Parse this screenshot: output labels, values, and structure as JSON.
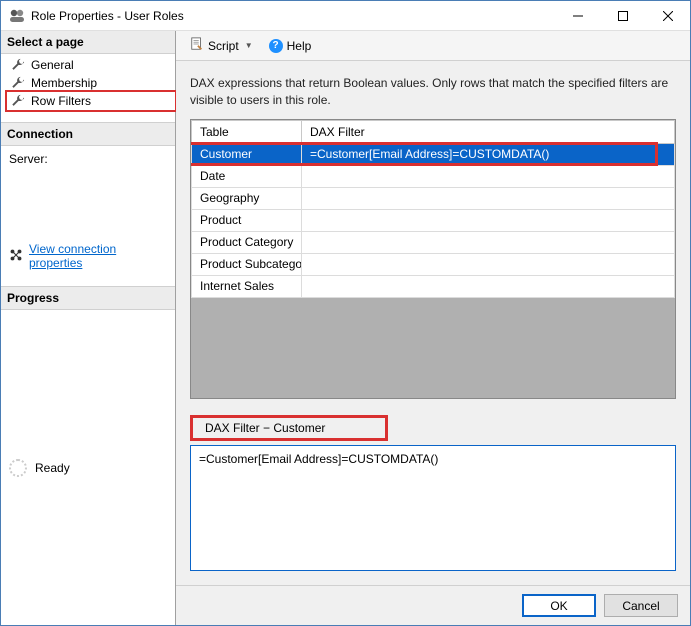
{
  "window": {
    "title": "Role Properties - User Roles"
  },
  "sidebar": {
    "pages_header": "Select a page",
    "items": [
      {
        "label": "General"
      },
      {
        "label": "Membership"
      },
      {
        "label": "Row Filters"
      }
    ],
    "connection_header": "Connection",
    "server_label": "Server:",
    "view_connection_label": "View connection properties",
    "progress_header": "Progress",
    "progress_status": "Ready"
  },
  "toolbar": {
    "script_label": "Script",
    "help_label": "Help"
  },
  "main": {
    "description": "DAX expressions that return Boolean values. Only rows that match the specified filters are visible to users in this role.",
    "columns": {
      "table": "Table",
      "dax": "DAX Filter"
    },
    "rows": [
      {
        "table": "Customer",
        "dax": "=Customer[Email Address]=CUSTOMDATA()"
      },
      {
        "table": "Date",
        "dax": ""
      },
      {
        "table": "Geography",
        "dax": ""
      },
      {
        "table": "Product",
        "dax": ""
      },
      {
        "table": "Product Category",
        "dax": ""
      },
      {
        "table": "Product Subcategory",
        "dax": ""
      },
      {
        "table": "Internet Sales",
        "dax": ""
      }
    ],
    "filter_section_label": "DAX Filter − Customer",
    "filter_value": "=Customer[Email Address]=CUSTOMDATA()"
  },
  "footer": {
    "ok": "OK",
    "cancel": "Cancel"
  }
}
